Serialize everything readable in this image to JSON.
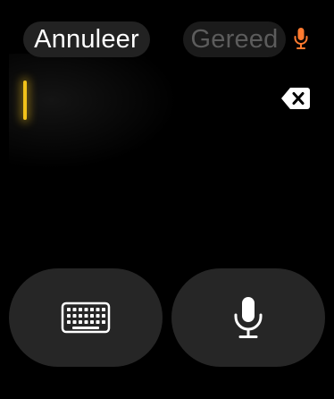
{
  "header": {
    "cancel_label": "Annuleer",
    "done_label": "Gereed",
    "mic_status_icon": "microphone-icon"
  },
  "input": {
    "text": "",
    "cursor_color": "#f2c21a",
    "delete_icon": "delete-backspace-icon"
  },
  "controls": {
    "keyboard_icon": "keyboard-icon",
    "dictation_icon": "microphone-icon"
  },
  "colors": {
    "accent": "#f2c21a",
    "mic_status": "#ff7a2f",
    "button_bg": "#262626"
  }
}
